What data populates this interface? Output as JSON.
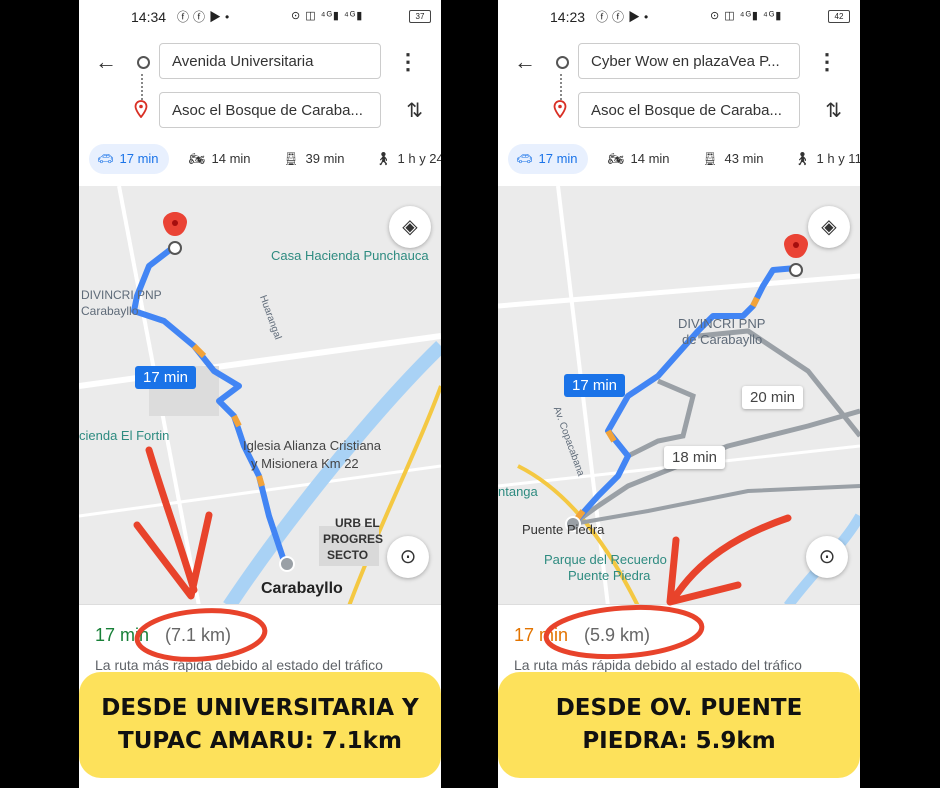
{
  "colors": {
    "route": "#4285f4",
    "traffic": "#f2a33a",
    "alt_route": "#9aa0a6",
    "accent": "#1a73e8",
    "duration_green": "#188038",
    "duration_orange": "#e37400",
    "callout_bg": "#fde15b",
    "annotation_red": "#e8432b"
  },
  "left": {
    "status": {
      "time": "14:34",
      "battery": "37"
    },
    "origin": "Avenida Universitaria",
    "destination": "Asoc el Bosque de Caraba...",
    "modes": [
      {
        "icon": "car-icon",
        "label": "17 min"
      },
      {
        "icon": "motorcycle-icon",
        "label": "14 min"
      },
      {
        "icon": "transit-icon",
        "label": "39 min"
      },
      {
        "icon": "walk-icon",
        "label": "1 h y 24"
      }
    ],
    "map_labels": {
      "place1": "Casa Hacienda Punchauca",
      "place2": "DIVINCRI PNP",
      "place2b": "Carabayllo",
      "road": "Huarangal",
      "place3": "cienda El Fortin",
      "place4": "Iglesia Alianza Cristiana",
      "place4b": "y Misionera Km 22",
      "place5": "URB EL",
      "place5b": "PROGRES",
      "place5c": "SECTO",
      "city": "Carabayllo"
    },
    "route_badge": "17 min",
    "summary": {
      "duration": "17 min",
      "distance": "(7.1 km)",
      "description": "La ruta más rápida debido al estado del tráfico"
    },
    "callout": "DESDE UNIVERSITARIA Y TUPAC AMARU: 7.1km"
  },
  "right": {
    "status": {
      "time": "14:23",
      "battery": "42"
    },
    "origin": "Cyber Wow en plazaVea P...",
    "destination": "Asoc el Bosque de Caraba...",
    "modes": [
      {
        "icon": "car-icon",
        "label": "17 min"
      },
      {
        "icon": "motorcycle-icon",
        "label": "14 min"
      },
      {
        "icon": "transit-icon",
        "label": "43 min"
      },
      {
        "icon": "walk-icon",
        "label": "1 h y 11"
      }
    ],
    "map_labels": {
      "place1": "DIVINCRI PNP",
      "place1b": "de Carabayllo",
      "road": "Av. Copacabana",
      "place2": "ntanga",
      "place3": "Puente Piedra",
      "place4": "Parque del Recuerdo",
      "place4b": "Puente Piedra"
    },
    "route_badge": "17 min",
    "alt_badge_1": "20 min",
    "alt_badge_2": "18 min",
    "summary": {
      "duration": "17 min",
      "distance": "(5.9 km)",
      "description": "La ruta más rápida debido al estado del tráfico"
    },
    "callout": "DESDE OV. PUENTE PIEDRA: 5.9km"
  }
}
